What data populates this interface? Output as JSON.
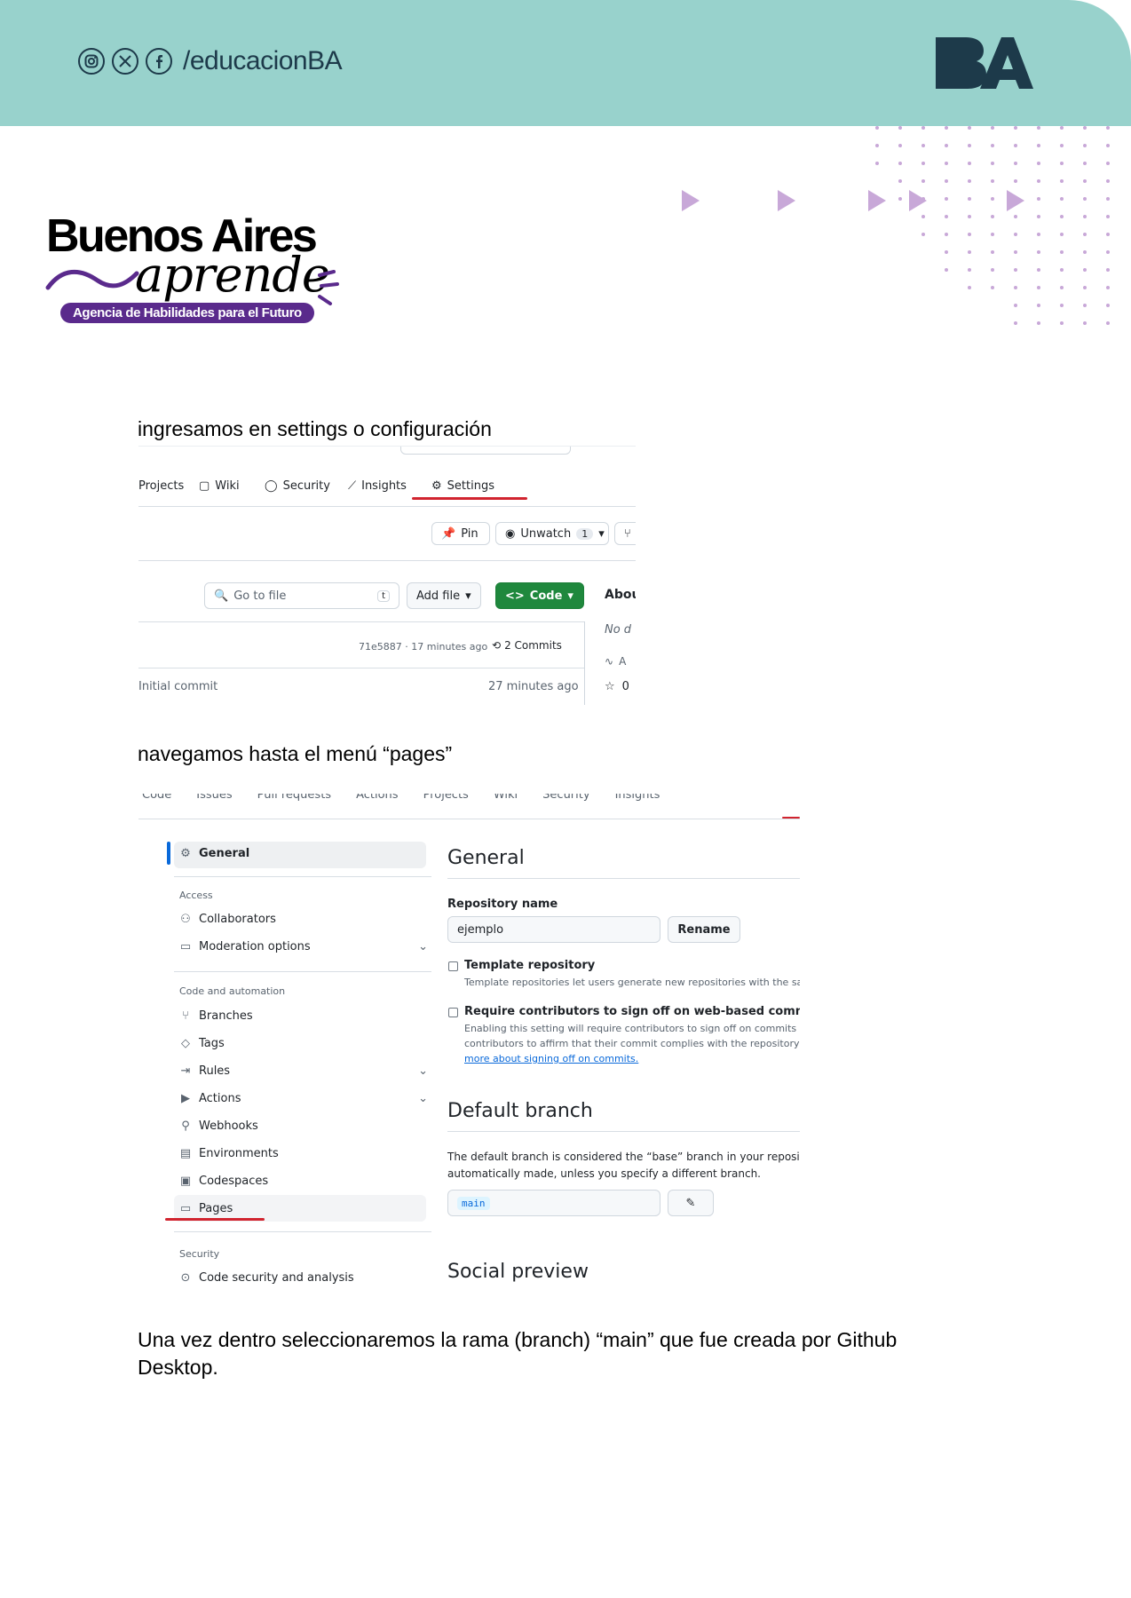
{
  "header": {
    "social_handle": "/educacionBA",
    "social_icons": [
      "instagram-icon",
      "x-icon",
      "facebook-icon"
    ],
    "brand_logo": "BA",
    "bg_color": "#98d2cc",
    "accent_color": "#c8a8d8"
  },
  "logo": {
    "title": "Buenos Aires",
    "script": "aprende",
    "tagline": "Agencia de Habilidades para el Futuro"
  },
  "paragraphs": {
    "p1": "ingresamos en settings o configuración",
    "p2": "navegamos hasta el menú “pages”",
    "p3": "Una vez dentro seleccionaremos la rama (branch) “main” que fue creada por Github Desktop."
  },
  "screenshot1": {
    "tabs": [
      "Projects",
      "Wiki",
      "Security",
      "Insights",
      "Settings"
    ],
    "pin": "Pin",
    "unwatch": "Unwatch",
    "unwatch_count": "1",
    "go_to_file": "Go to file",
    "go_to_file_key": "t",
    "add_file": "Add file",
    "code": "Code",
    "about": "Abou",
    "no_desc": "No d",
    "commit_hash": "71e5887 · 17 minutes ago",
    "commits": "2 Commits",
    "initial_commit": "Initial commit",
    "initial_time": "27 minutes ago",
    "about_a": "A",
    "stars": "0"
  },
  "screenshot2": {
    "top_tabs": [
      "Code",
      "Issues",
      "Pull requests",
      "Actions",
      "Projects",
      "Wiki",
      "Security",
      "Insights"
    ],
    "sidebar": {
      "general": "General",
      "access_head": "Access",
      "collaborators": "Collaborators",
      "moderation": "Moderation options",
      "code_head": "Code and automation",
      "branches": "Branches",
      "tags": "Tags",
      "rules": "Rules",
      "actions": "Actions",
      "webhooks": "Webhooks",
      "environments": "Environments",
      "codespaces": "Codespaces",
      "pages": "Pages",
      "security_head": "Security",
      "code_security": "Code security and analysis"
    },
    "main": {
      "general_title": "General",
      "repo_name_label": "Repository name",
      "repo_name_value": "ejemplo",
      "rename": "Rename",
      "template_label": "Template repository",
      "template_desc": "Template repositories let users generate new repositories with the same di",
      "signoff_label": "Require contributors to sign off on web-based commits",
      "signoff_desc1": "Enabling this setting will require contributors to sign off on commits made",
      "signoff_desc2": "contributors to affirm that their commit complies with the repository's ter",
      "signoff_link": "more about signing off on commits.",
      "default_branch_title": "Default branch",
      "default_desc1": "The default branch is considered the “base” branch in your reposito",
      "default_desc2": "automatically made, unless you specify a different branch.",
      "branch_value": "main",
      "social_title": "Social preview"
    }
  }
}
